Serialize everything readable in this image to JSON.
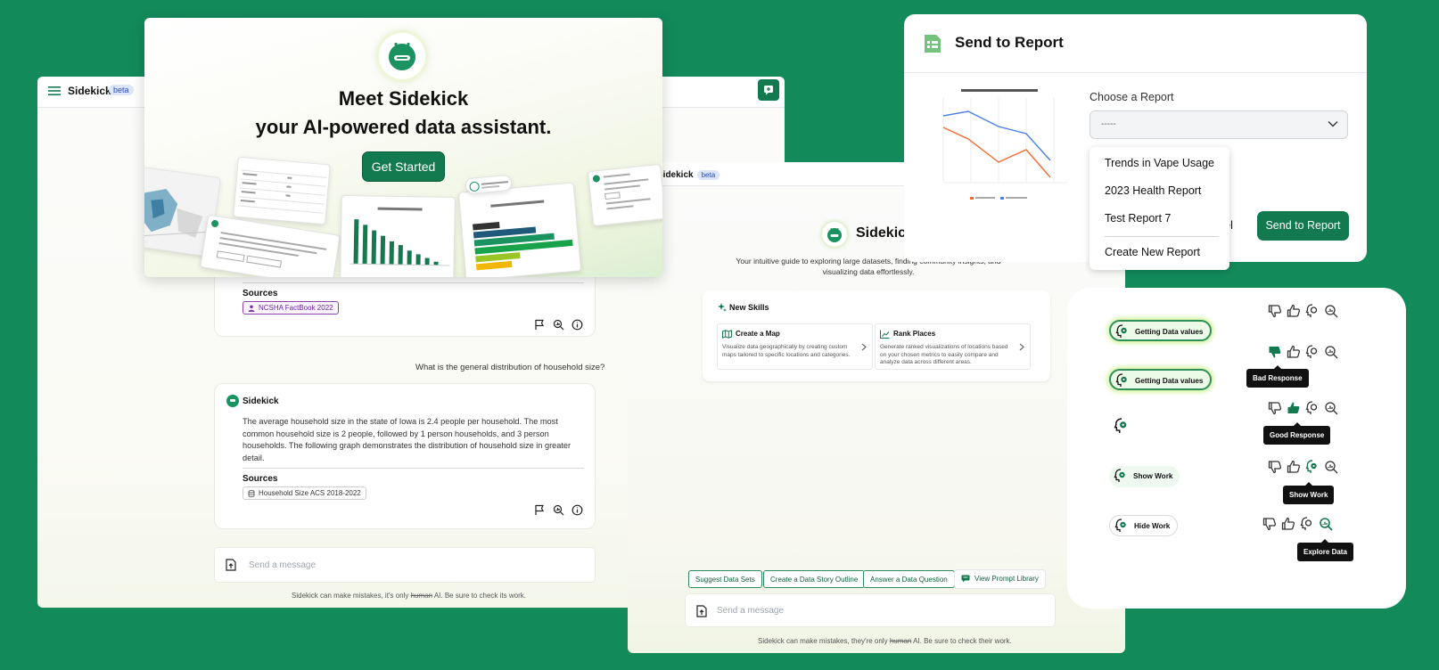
{
  "chat": {
    "brand": "Sidekick",
    "beta": "beta",
    "sources_label": "Sources",
    "source_1": "NCSHA FactBook 2022",
    "user_question": "What is the general distribution of household size?",
    "assistant_name": "Sidekick",
    "answer": "The average household size in the state of Iowa is 2.4 people per household. The most common household size is 2 people, followed by 1 person households, and 3 person households. The following graph demonstrates the distribution of household size in greater detail.",
    "source_2": "Household Size ACS 2018-2022",
    "input_placeholder": "Send a message",
    "disclaimer_pre": "Sidekick can make mistakes, it's only ",
    "disclaimer_struck": "human",
    "disclaimer_post": " AI. Be sure to check its work."
  },
  "hero": {
    "line1": "Meet Sidekick",
    "line2": "your AI-powered data assistant.",
    "button": "Get Started"
  },
  "sidekick2": {
    "brand": "Sidekick",
    "beta": "beta",
    "name": "Sidekick",
    "intro": "Your intuitive guide to exploring large datasets, finding community insights, and visualizing data effortlessly.",
    "skills_title": "New Skills",
    "skills": [
      {
        "name": "Create a Map",
        "desc": "Visualize data geographically by creating custom maps tailored to specific locations and categories."
      },
      {
        "name": "Rank Places",
        "desc": "Generate ranked visualizations of locations based on your chosen metrics to easily compare and analyze data across different areas."
      }
    ],
    "suggestions": [
      "Suggest Data Sets",
      "Create a Data Story Outline",
      "Answer a Data Question"
    ],
    "library": "View Prompt Library",
    "input_placeholder": "Send a message",
    "disclaimer_pre": "Sidekick can make mistakes, they're only ",
    "disclaimer_struck": "human",
    "disclaimer_post": " AI. Be sure to check their work."
  },
  "report": {
    "title": "Send to Report",
    "choose_label": "Choose a Report",
    "select_value": "-----",
    "cancel": "Cancel",
    "send": "Send to Report",
    "options": [
      "Trends in Vape Usage",
      "2023 Health Report",
      "Test Report 7",
      "Create New Report"
    ]
  },
  "states": {
    "pills": [
      "Getting Data values",
      "Getting Data values",
      "Show Work",
      "Hide Work"
    ],
    "tooltips": [
      "Bad Response",
      "Good Response",
      "Show Work",
      "Explore Data"
    ]
  },
  "colors": {
    "background": "#138a5a",
    "primary": "#137a4f",
    "accent_glow": "#cdf28f"
  }
}
